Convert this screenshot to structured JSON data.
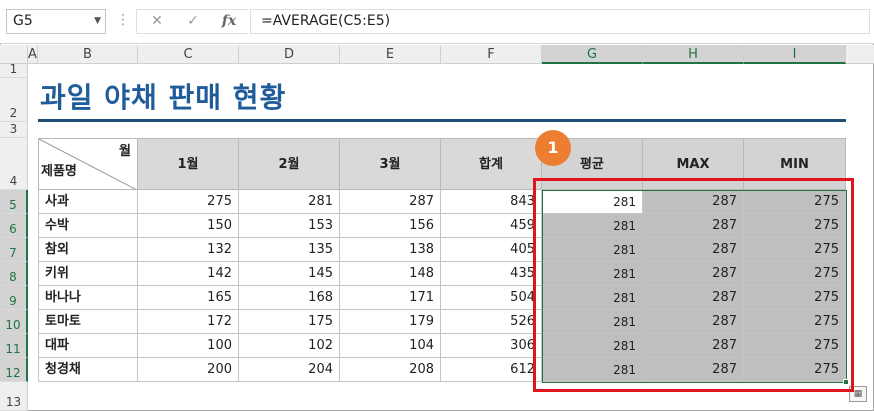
{
  "formula_bar": {
    "name_box": "G5",
    "formula": "=AVERAGE(C5:E5)",
    "cancel_icon": "✕",
    "enter_icon": "✓",
    "fx_label": "fx"
  },
  "columns": [
    "A",
    "B",
    "C",
    "D",
    "E",
    "F",
    "G",
    "H",
    "I"
  ],
  "rows": [
    "1",
    "2",
    "3",
    "4",
    "5",
    "6",
    "7",
    "8",
    "9",
    "10",
    "11",
    "12",
    "13"
  ],
  "title": "과일 야채 판매 현황",
  "badge": "1",
  "table": {
    "corner_top": "월",
    "corner_bottom": "제품명",
    "headers": [
      "1월",
      "2월",
      "3월",
      "합계",
      "평균",
      "MAX",
      "MIN"
    ],
    "data": [
      {
        "name": "사과",
        "c": "275",
        "d": "281",
        "e": "287",
        "f": "843",
        "g": "281",
        "h": "287",
        "i": "275"
      },
      {
        "name": "수박",
        "c": "150",
        "d": "153",
        "e": "156",
        "f": "459",
        "g": "281",
        "h": "287",
        "i": "275"
      },
      {
        "name": "참외",
        "c": "132",
        "d": "135",
        "e": "138",
        "f": "405",
        "g": "281",
        "h": "287",
        "i": "275"
      },
      {
        "name": "키위",
        "c": "142",
        "d": "145",
        "e": "148",
        "f": "435",
        "g": "281",
        "h": "287",
        "i": "275"
      },
      {
        "name": "바나나",
        "c": "165",
        "d": "168",
        "e": "171",
        "f": "504",
        "g": "281",
        "h": "287",
        "i": "275"
      },
      {
        "name": "토마토",
        "c": "172",
        "d": "175",
        "e": "179",
        "f": "526",
        "g": "281",
        "h": "287",
        "i": "275"
      },
      {
        "name": "대파",
        "c": "100",
        "d": "102",
        "e": "104",
        "f": "306",
        "g": "281",
        "h": "287",
        "i": "275"
      },
      {
        "name": "청경채",
        "c": "200",
        "d": "204",
        "e": "208",
        "f": "612",
        "g": "281",
        "h": "287",
        "i": "275"
      }
    ]
  },
  "colors": {
    "selection": "#217346",
    "highlight_box": "#e0161c",
    "badge": "#ed7d31",
    "title": "#1f5c99"
  }
}
